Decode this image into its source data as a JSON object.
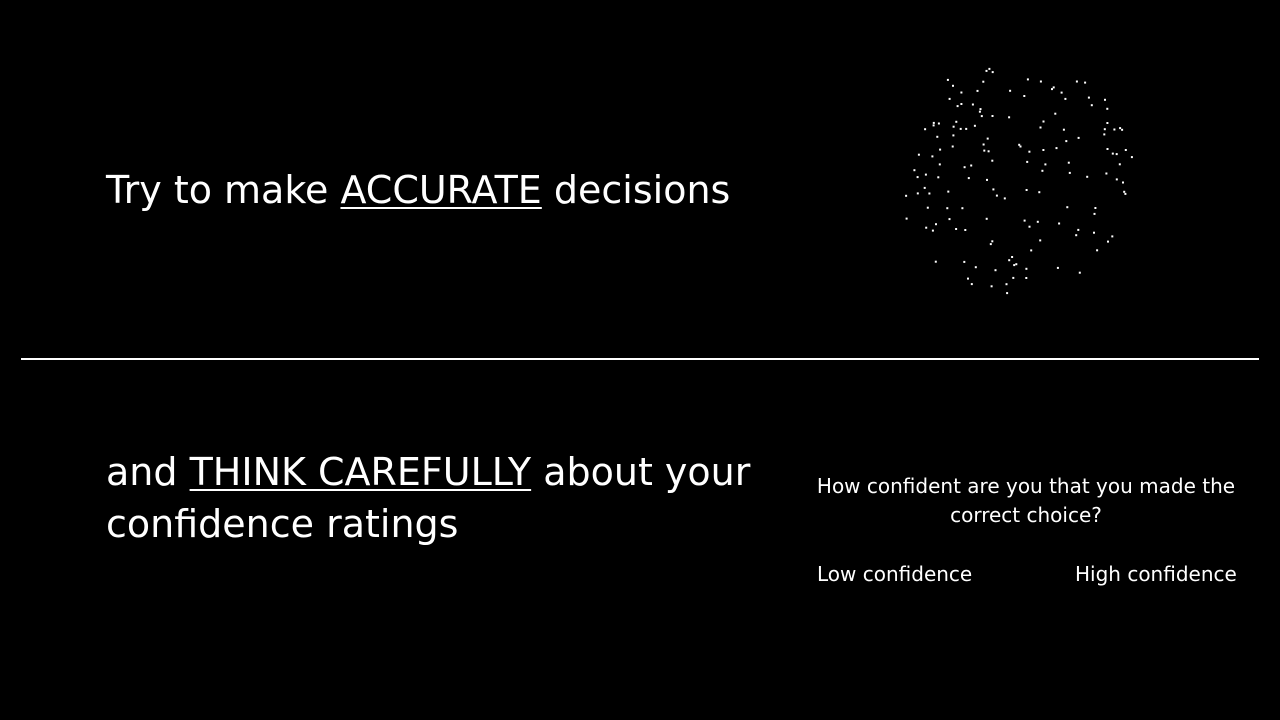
{
  "instruction_top": {
    "prefix": "Try to make ",
    "emphasis": "ACCURATE",
    "suffix": " decisions"
  },
  "instruction_bottom": {
    "prefix": "and ",
    "emphasis": "THINK CAREFULLY",
    "suffix": " about your confidence ratings"
  },
  "confidence_prompt": {
    "question": "How confident are you that you made the correct choice?",
    "low_label": "Low confidence",
    "high_label": "High confidence"
  },
  "colors": {
    "background": "#000000",
    "foreground": "#ffffff"
  }
}
